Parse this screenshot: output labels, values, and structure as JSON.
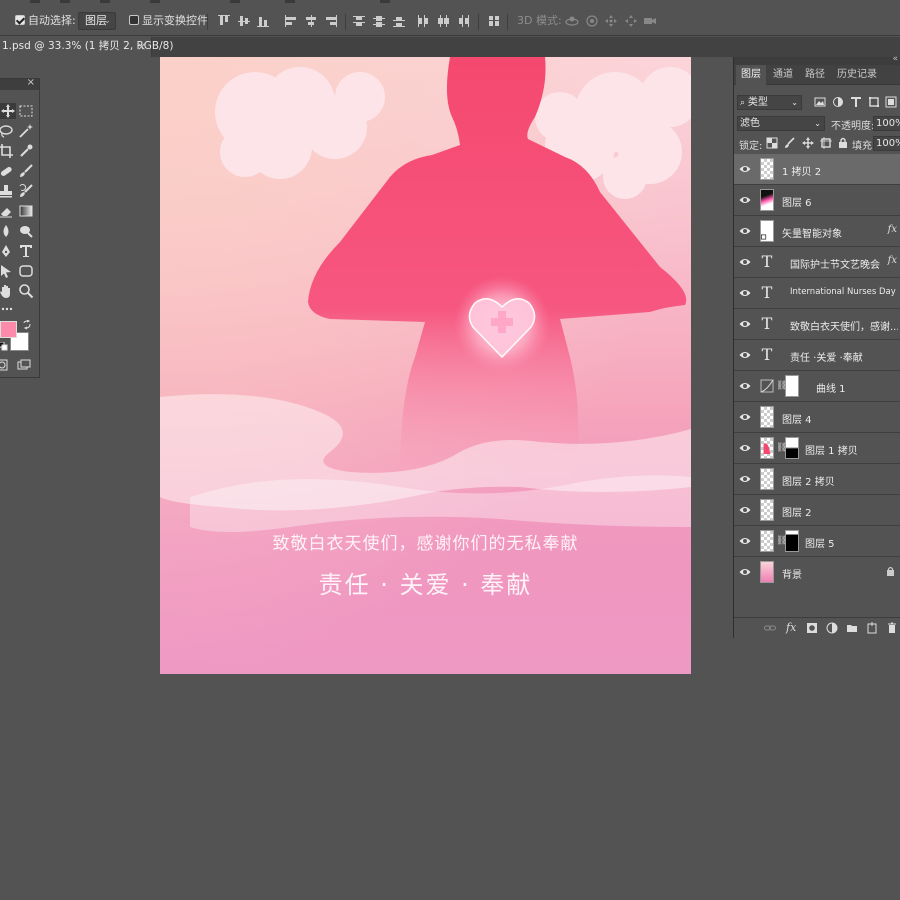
{
  "options_bar": {
    "auto_select_label": "自动选择:",
    "auto_select_checked": true,
    "auto_select_target": "图层",
    "show_transform_label": "显示变换控件",
    "show_transform_checked": false,
    "mode_3d_label": "3D 模式:"
  },
  "document_tab": {
    "title": "1.psd @ 33.3% (1 拷贝 2, RGB/8)",
    "close": "×"
  },
  "toolbox": {
    "close": "×",
    "foreground_color": "#fb8ba8",
    "background_color": "#ffffff",
    "tools": [
      "move-icon",
      "marquee-icon",
      "lasso-icon",
      "magic-wand-icon",
      "crop-icon",
      "eyedropper-icon",
      "healing-icon",
      "brush-icon",
      "stamp-icon",
      "history-brush-icon",
      "eraser-icon",
      "gradient-icon",
      "blur-icon",
      "dodge-icon",
      "pen-icon",
      "type-icon",
      "path-select-icon",
      "shape-icon",
      "hand-icon",
      "zoom-icon"
    ]
  },
  "canvas": {
    "slogan": "致敬白衣天使们，感谢你们的无私奉献",
    "values": "责任 · 关爱 · 奉献",
    "accent_color": "#f5486f"
  },
  "layers_panel": {
    "tabs": [
      "图层",
      "通道",
      "路径",
      "历史记录"
    ],
    "active_tab": "图层",
    "filter_type": "类型",
    "blend_mode": "滤色",
    "opacity_label": "不透明度:",
    "opacity": "100%",
    "lock_label": "锁定:",
    "fill_label": "填充:",
    "fill": "100%",
    "layers": [
      {
        "name": "1 拷贝 2",
        "kind": "pixel",
        "selected": true
      },
      {
        "name": "图层 6",
        "kind": "pixel-dark"
      },
      {
        "name": "矢量智能对象",
        "kind": "smart",
        "fx": "fx"
      },
      {
        "name": "国际护士节文艺晚会",
        "kind": "text",
        "fx": "fx"
      },
      {
        "name": "International Nurses Day",
        "kind": "text"
      },
      {
        "name": "致敬白衣天使们，感谢...",
        "kind": "text"
      },
      {
        "name": "责任 ·关爱 ·奉献",
        "kind": "text"
      },
      {
        "name": "曲线 1",
        "kind": "adjustment"
      },
      {
        "name": "图层 4",
        "kind": "pixel"
      },
      {
        "name": "图层 1 拷贝",
        "kind": "masked"
      },
      {
        "name": "图层 2 拷贝",
        "kind": "pixel"
      },
      {
        "name": "图层 2",
        "kind": "pixel"
      },
      {
        "name": "图层 5",
        "kind": "masked-black"
      },
      {
        "name": "背景",
        "kind": "background",
        "locked": true
      }
    ],
    "text_glyph": "T"
  }
}
